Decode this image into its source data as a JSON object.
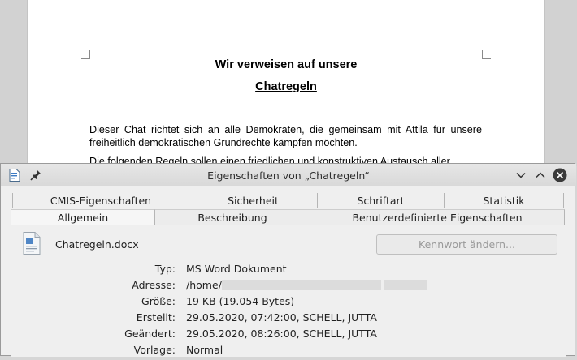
{
  "document": {
    "heading1": "Wir verweisen auf unsere",
    "heading2": "Chatregeln",
    "para1": "Dieser Chat richtet sich an alle Demokraten, die gemeinsam mit Attila für unsere freiheitlich demokratischen Grundrechte kämpfen möchten.",
    "para2_partial": "Die folgenden Regeln sollen einen friedlichen und konstruktiven Austausch aller"
  },
  "dialog": {
    "title": "Eigenschaften von „Chatregeln“",
    "tabs_row1": [
      "CMIS-Eigenschaften",
      "Sicherheit",
      "Schriftart",
      "Statistik"
    ],
    "tabs_row2": [
      "Allgemein",
      "Beschreibung",
      "Benutzerdefinierte Eigenschaften"
    ],
    "active_tab": "Allgemein",
    "file_name": "Chatregeln.docx",
    "password_button": "Kennwort ändern...",
    "properties": {
      "type_label": "Typ:",
      "type_value": "MS Word Dokument",
      "address_label": "Adresse:",
      "address_value": "/home/",
      "size_label": "Größe:",
      "size_value": "19 KB (19.054 Bytes)",
      "created_label": "Erstellt:",
      "created_value": "29.05.2020, 07:42:00, SCHELL, JUTTA",
      "modified_label": "Geändert:",
      "modified_value": "29.05.2020, 08:26:00, SCHELL, JUTTA",
      "template_label": "Vorlage:",
      "template_value": "Normal"
    },
    "icons": {
      "app": "document-properties-icon",
      "pin": "pin-icon",
      "minimize": "chevron-down-icon",
      "maximize": "chevron-up-icon",
      "close": "close-icon",
      "file": "word-document-icon"
    }
  }
}
